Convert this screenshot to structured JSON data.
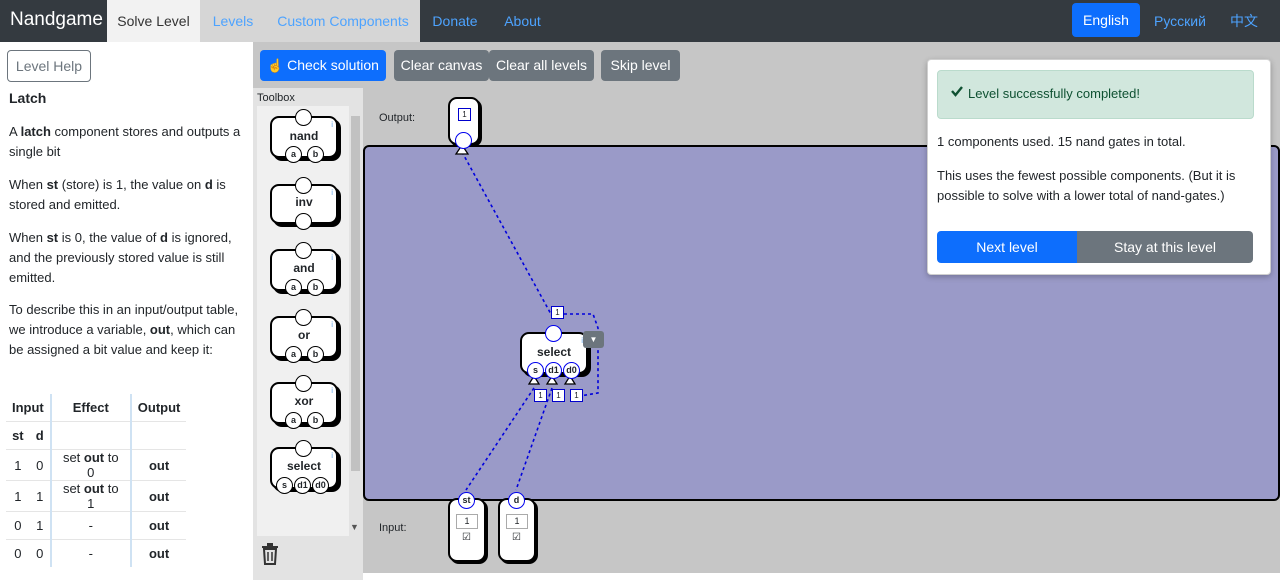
{
  "nav": {
    "brand": "Nandgame",
    "tabs": [
      "Solve Level",
      "Levels",
      "Custom Components",
      "Donate",
      "About"
    ],
    "languages": [
      "English",
      "Русский",
      "中文"
    ]
  },
  "help": {
    "button": "Level Help",
    "title": "Latch",
    "p1_a": "A ",
    "p1_b": "latch",
    "p1_c": " component stores and outputs a single bit",
    "p2_a": "When ",
    "p2_b": "st",
    "p2_c": " (store) is 1, the value on ",
    "p2_d": "d",
    "p2_e": " is stored and emitted.",
    "p3_a": "When ",
    "p3_b": "st",
    "p3_c": " is 0, the value of ",
    "p3_d": "d",
    "p3_e": " is ignored, and the previously stored value is still emitted.",
    "p4_a": "To describe this in an input/output table, we introduce a variable, ",
    "p4_b": "out",
    "p4_c": ", which can be assigned a bit value and keep it:",
    "table": {
      "headers": [
        "Input",
        "Effect",
        "Output"
      ],
      "subheaders": [
        "st",
        "d"
      ],
      "rows": [
        [
          "1",
          "0",
          "set",
          "out",
          "to 0",
          "out"
        ],
        [
          "1",
          "1",
          "set",
          "out",
          "to 1",
          "out"
        ],
        [
          "0",
          "1",
          "-",
          "",
          "",
          "out"
        ],
        [
          "0",
          "0",
          "-",
          "",
          "",
          "out"
        ]
      ]
    }
  },
  "toolbar": {
    "check": "Check solution",
    "clear_canvas": "Clear canvas",
    "clear_all": "Clear all levels",
    "skip": "Skip level"
  },
  "toolbox": {
    "label": "Toolbox",
    "items": [
      {
        "name": "nand",
        "pins": [
          "a",
          "b"
        ]
      },
      {
        "name": "inv",
        "pins": []
      },
      {
        "name": "and",
        "pins": [
          "a",
          "b"
        ]
      },
      {
        "name": "or",
        "pins": [
          "a",
          "b"
        ]
      },
      {
        "name": "xor",
        "pins": [
          "a",
          "b"
        ]
      },
      {
        "name": "select",
        "pins": [
          "s",
          "d1",
          "d0"
        ]
      }
    ]
  },
  "canvas": {
    "output_label": "Output:",
    "input_label": "Input:",
    "output_value": "1",
    "select_component": {
      "name": "select",
      "pins": [
        "s",
        "d1",
        "d0"
      ],
      "out_value": "1",
      "pin_values": [
        "1",
        "1",
        "1"
      ]
    },
    "inputs": [
      {
        "name": "st",
        "value": "1",
        "checked": true
      },
      {
        "name": "d",
        "value": "1",
        "checked": true
      }
    ]
  },
  "modal": {
    "alert": "Level successfully completed!",
    "line1": "1 components used. 15 nand gates in total.",
    "line2": "This uses the fewest possible components. (But it is possible to solve with a lower total of nand-gates.)",
    "next": "Next level",
    "stay": "Stay at this level"
  }
}
